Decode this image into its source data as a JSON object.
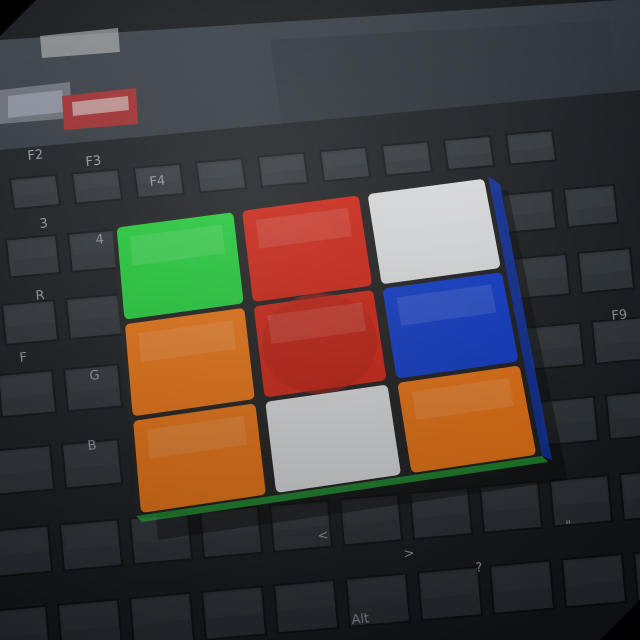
{
  "scene": {
    "description_free": true,
    "colors": {
      "background": "#0e1114",
      "laptop_body": "#2a3138",
      "laptop_body_dark": "#1c2228",
      "touchpad": "#262d34",
      "keyboard_base": "#15191d",
      "key": "#2b3137",
      "key_light": "#3a4148",
      "cube_body": "#1a1a1a",
      "sticker_green": "#1fe03a",
      "sticker_red": "#e0200e",
      "sticker_white": "#eef0f2",
      "sticker_orange": "#ff7a0e",
      "sticker_blue": "#0a3ad8"
    },
    "cube": {
      "face_grid": [
        [
          "green",
          "red",
          "white"
        ],
        [
          "orange",
          "red",
          "blue"
        ],
        [
          "orange",
          "white",
          "orange"
        ]
      ]
    },
    "keyboard": {
      "visible_key_labels": [
        "F2",
        "F3",
        "F4",
        "F9",
        "3",
        "4",
        "R",
        "F",
        "G",
        "B",
        "<",
        ">",
        "?",
        "Alt",
        "\""
      ]
    },
    "stickers_on_laptop": [
      {
        "icon": "sticker-label-icon"
      },
      {
        "icon": "sticker-label-icon"
      }
    ]
  }
}
